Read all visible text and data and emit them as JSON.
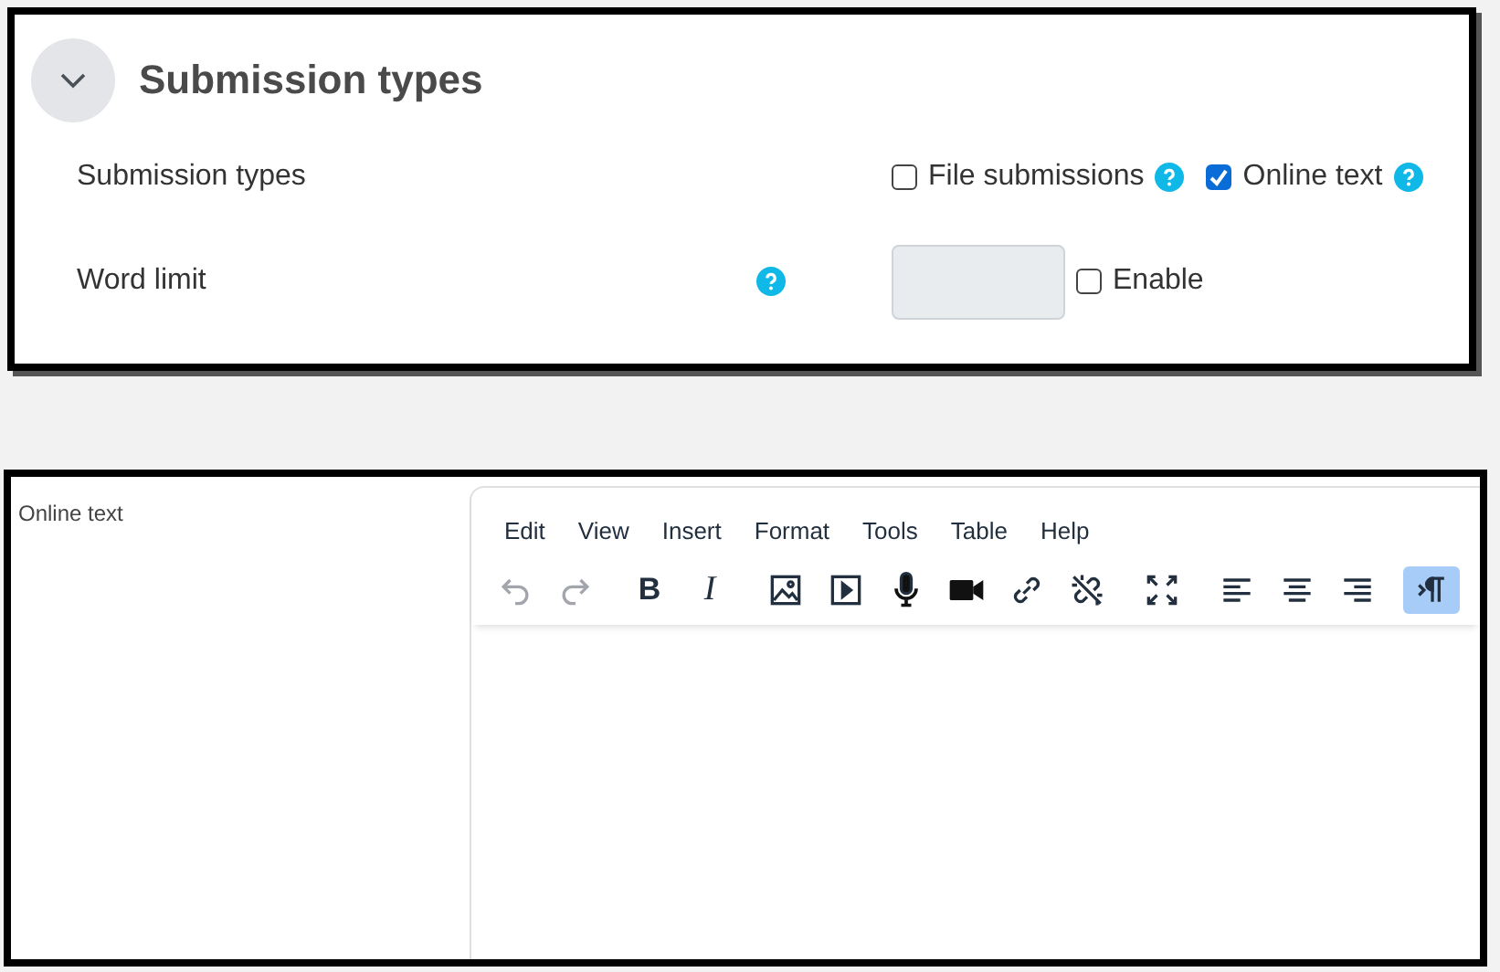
{
  "section": {
    "title": "Submission types",
    "expanded": true
  },
  "rows": [
    {
      "label": "Submission types",
      "options": [
        {
          "label": "File submissions",
          "checked": false
        },
        {
          "label": "Online text",
          "checked": true
        }
      ]
    },
    {
      "label": "Word limit",
      "value": "",
      "options": [
        {
          "label": "Enable",
          "checked": false
        }
      ]
    }
  ],
  "editor": {
    "label": "Online text",
    "menu": [
      "Edit",
      "View",
      "Insert",
      "Format",
      "Tools",
      "Table",
      "Help"
    ],
    "toolbar": [
      [
        {
          "kind": "undo",
          "disabled": true,
          "selected": false
        },
        {
          "kind": "redo",
          "disabled": true,
          "selected": false
        }
      ],
      [
        {
          "kind": "bold",
          "text": "B",
          "disabled": false,
          "selected": false
        },
        {
          "kind": "italic",
          "text": "I",
          "disabled": false,
          "selected": false
        }
      ],
      [
        {
          "kind": "image",
          "disabled": false,
          "selected": false
        },
        {
          "kind": "media",
          "disabled": false,
          "selected": false
        },
        {
          "kind": "mic",
          "disabled": false,
          "selected": false
        },
        {
          "kind": "video",
          "disabled": false,
          "selected": false
        },
        {
          "kind": "link",
          "disabled": false,
          "selected": false
        },
        {
          "kind": "unlink",
          "disabled": false,
          "selected": false
        }
      ],
      [
        {
          "kind": "fullscreen",
          "disabled": false,
          "selected": false
        }
      ],
      [
        {
          "kind": "align-left",
          "disabled": false,
          "selected": false
        },
        {
          "kind": "align-center",
          "disabled": false,
          "selected": false
        },
        {
          "kind": "align-right",
          "disabled": false,
          "selected": false
        }
      ],
      [
        {
          "kind": "ltr",
          "disabled": false,
          "selected": true
        }
      ]
    ]
  }
}
